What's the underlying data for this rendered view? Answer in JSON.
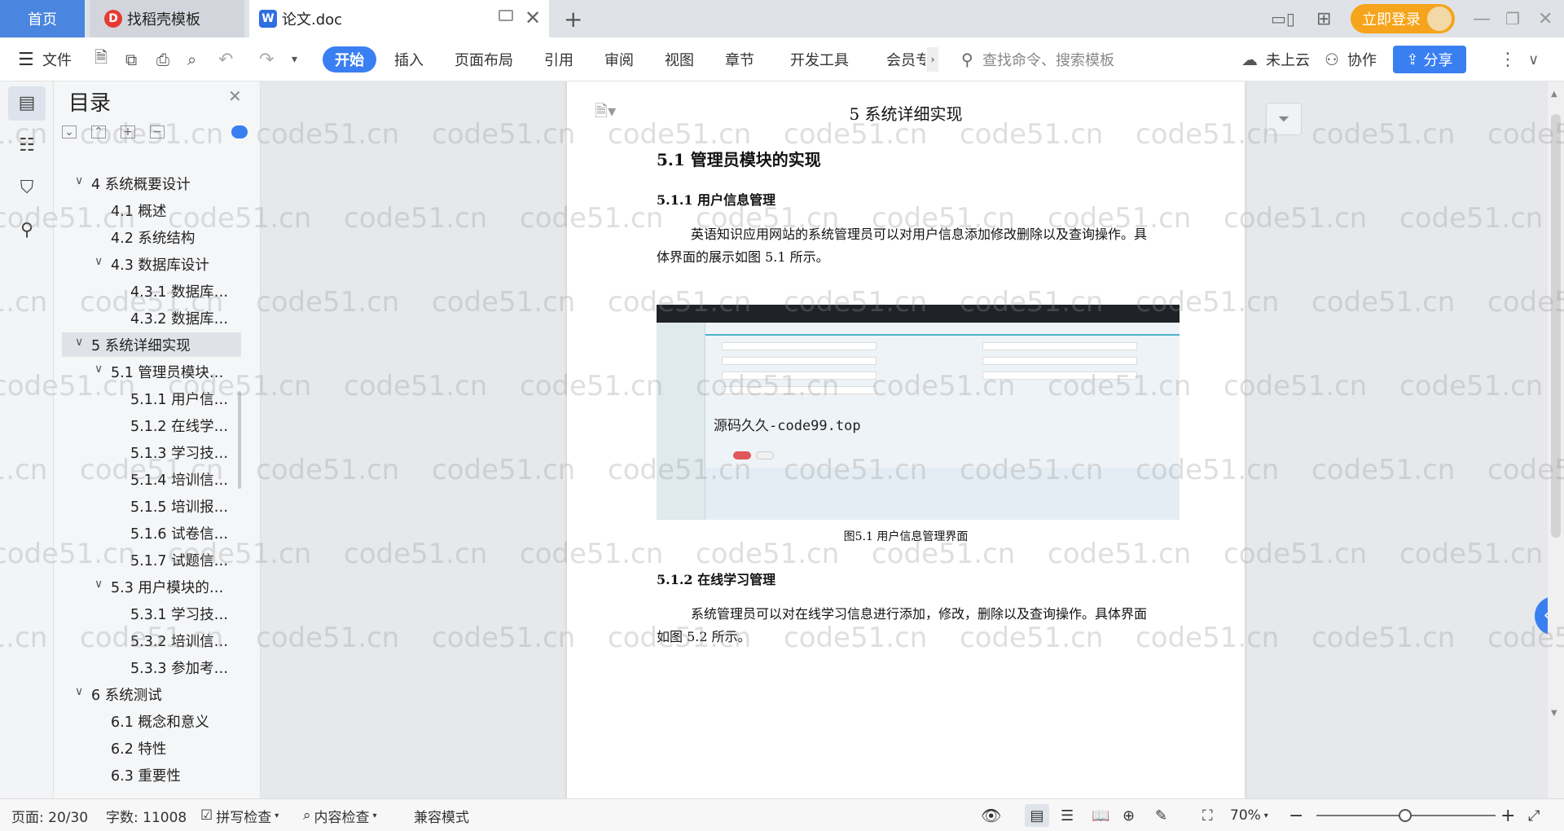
{
  "tabs": {
    "home": "首页",
    "template": "找稻壳模板",
    "doc": "论文.doc",
    "login": "立即登录"
  },
  "toolbar": {
    "file": "文件",
    "ribbon": [
      "开始",
      "插入",
      "页面布局",
      "引用",
      "审阅",
      "视图",
      "章节",
      "开发工具",
      "会员专"
    ],
    "search_placeholder": "查找命令、搜索模板",
    "cloud": "未上云",
    "collab": "协作",
    "share": "分享"
  },
  "toc": {
    "title": "目录",
    "items": [
      {
        "label": "4 系统概要设计",
        "level": 0,
        "arrow": "∨"
      },
      {
        "label": "4.1 概述",
        "level": 1,
        "arrow": ""
      },
      {
        "label": "4.2 系统结构",
        "level": 1,
        "arrow": ""
      },
      {
        "label": "4.3 数据库设计",
        "level": 1,
        "arrow": "∨"
      },
      {
        "label": "4.3.1 数据库…",
        "level": 2,
        "arrow": ""
      },
      {
        "label": "4.3.2 数据库…",
        "level": 2,
        "arrow": ""
      },
      {
        "label": "5 系统详细实现",
        "level": 0,
        "arrow": "∨",
        "selected": true
      },
      {
        "label": "5.1  管理员模块…",
        "level": 1,
        "arrow": "∨"
      },
      {
        "label": "5.1.1  用户信…",
        "level": 2,
        "arrow": ""
      },
      {
        "label": "5.1.2  在线学…",
        "level": 2,
        "arrow": ""
      },
      {
        "label": "5.1.3  学习技…",
        "level": 2,
        "arrow": ""
      },
      {
        "label": "5.1.4  培训信…",
        "level": 2,
        "arrow": ""
      },
      {
        "label": "5.1.5  培训报…",
        "level": 2,
        "arrow": ""
      },
      {
        "label": "5.1.6  试卷信…",
        "level": 2,
        "arrow": ""
      },
      {
        "label": "5.1.7  试题信…",
        "level": 2,
        "arrow": ""
      },
      {
        "label": "5.3  用户模块的…",
        "level": 1,
        "arrow": "∨"
      },
      {
        "label": "5.3.1  学习技…",
        "level": 2,
        "arrow": ""
      },
      {
        "label": "5.3.2  培训信…",
        "level": 2,
        "arrow": ""
      },
      {
        "label": "5.3.3  参加考…",
        "level": 2,
        "arrow": ""
      },
      {
        "label": "6 系统测试",
        "level": 0,
        "arrow": "∨"
      },
      {
        "label": "6.1 概念和意义",
        "level": 1,
        "arrow": ""
      },
      {
        "label": "6.2 特性",
        "level": 1,
        "arrow": ""
      },
      {
        "label": "6.3 重要性",
        "level": 1,
        "arrow": ""
      }
    ]
  },
  "document": {
    "chapter": "5 系统详细实现",
    "h2": "5.1  管理员模块的实现",
    "h3a": "5.1.1  用户信息管理",
    "p1a": "英语知识应用网站的系统管理员可以对用户信息添加修改删除以及查询操作。具",
    "p1b": "体界面的展示如图 5.1 所示。",
    "caption": "图5.1  用户信息管理界面",
    "h3b": "5.1.2  在线学习管理",
    "p2a": "系统管理员可以对在线学习信息进行添加，修改，删除以及查询操作。具体界面",
    "p2b": "如图 5.2 所示。",
    "figure_overlay": "源码久久-code99.top"
  },
  "watermark": "code51.cn",
  "status": {
    "page": "页面: 20/30",
    "words": "字数: 11008",
    "spell": "拼写检查",
    "content": "内容检查",
    "compat": "兼容模式",
    "zoom": "70%",
    "zoom_level_percent": 70
  },
  "colors": {
    "accent": "#3a7ff2",
    "login": "#f6a41b"
  }
}
